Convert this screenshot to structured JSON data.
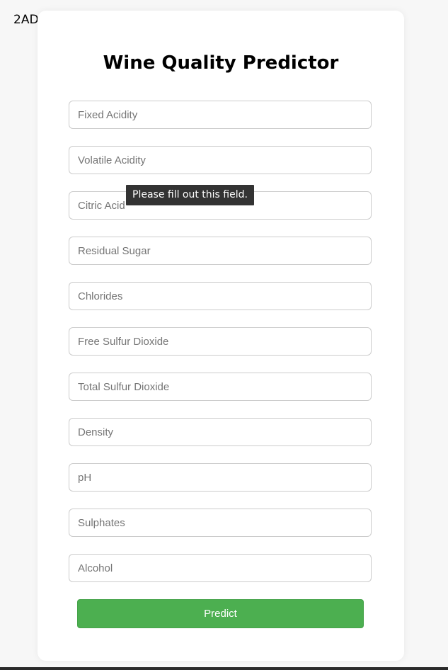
{
  "corner_label": "2AD",
  "form": {
    "title": "Wine Quality Predictor",
    "fields": [
      {
        "placeholder": "Fixed Acidity",
        "value": ""
      },
      {
        "placeholder": "Volatile Acidity",
        "value": ""
      },
      {
        "placeholder": "Citric Acid",
        "value": ""
      },
      {
        "placeholder": "Residual Sugar",
        "value": ""
      },
      {
        "placeholder": "Chlorides",
        "value": ""
      },
      {
        "placeholder": "Free Sulfur Dioxide",
        "value": ""
      },
      {
        "placeholder": "Total Sulfur Dioxide",
        "value": ""
      },
      {
        "placeholder": "Density",
        "value": ""
      },
      {
        "placeholder": "pH",
        "value": ""
      },
      {
        "placeholder": "Sulphates",
        "value": ""
      },
      {
        "placeholder": "Alcohol",
        "value": ""
      }
    ],
    "submit_label": "Predict"
  },
  "validation_tooltip": "Please fill out this field.",
  "colors": {
    "button": "#4caf50",
    "background": "#f7f7f7",
    "card": "#ffffff"
  }
}
